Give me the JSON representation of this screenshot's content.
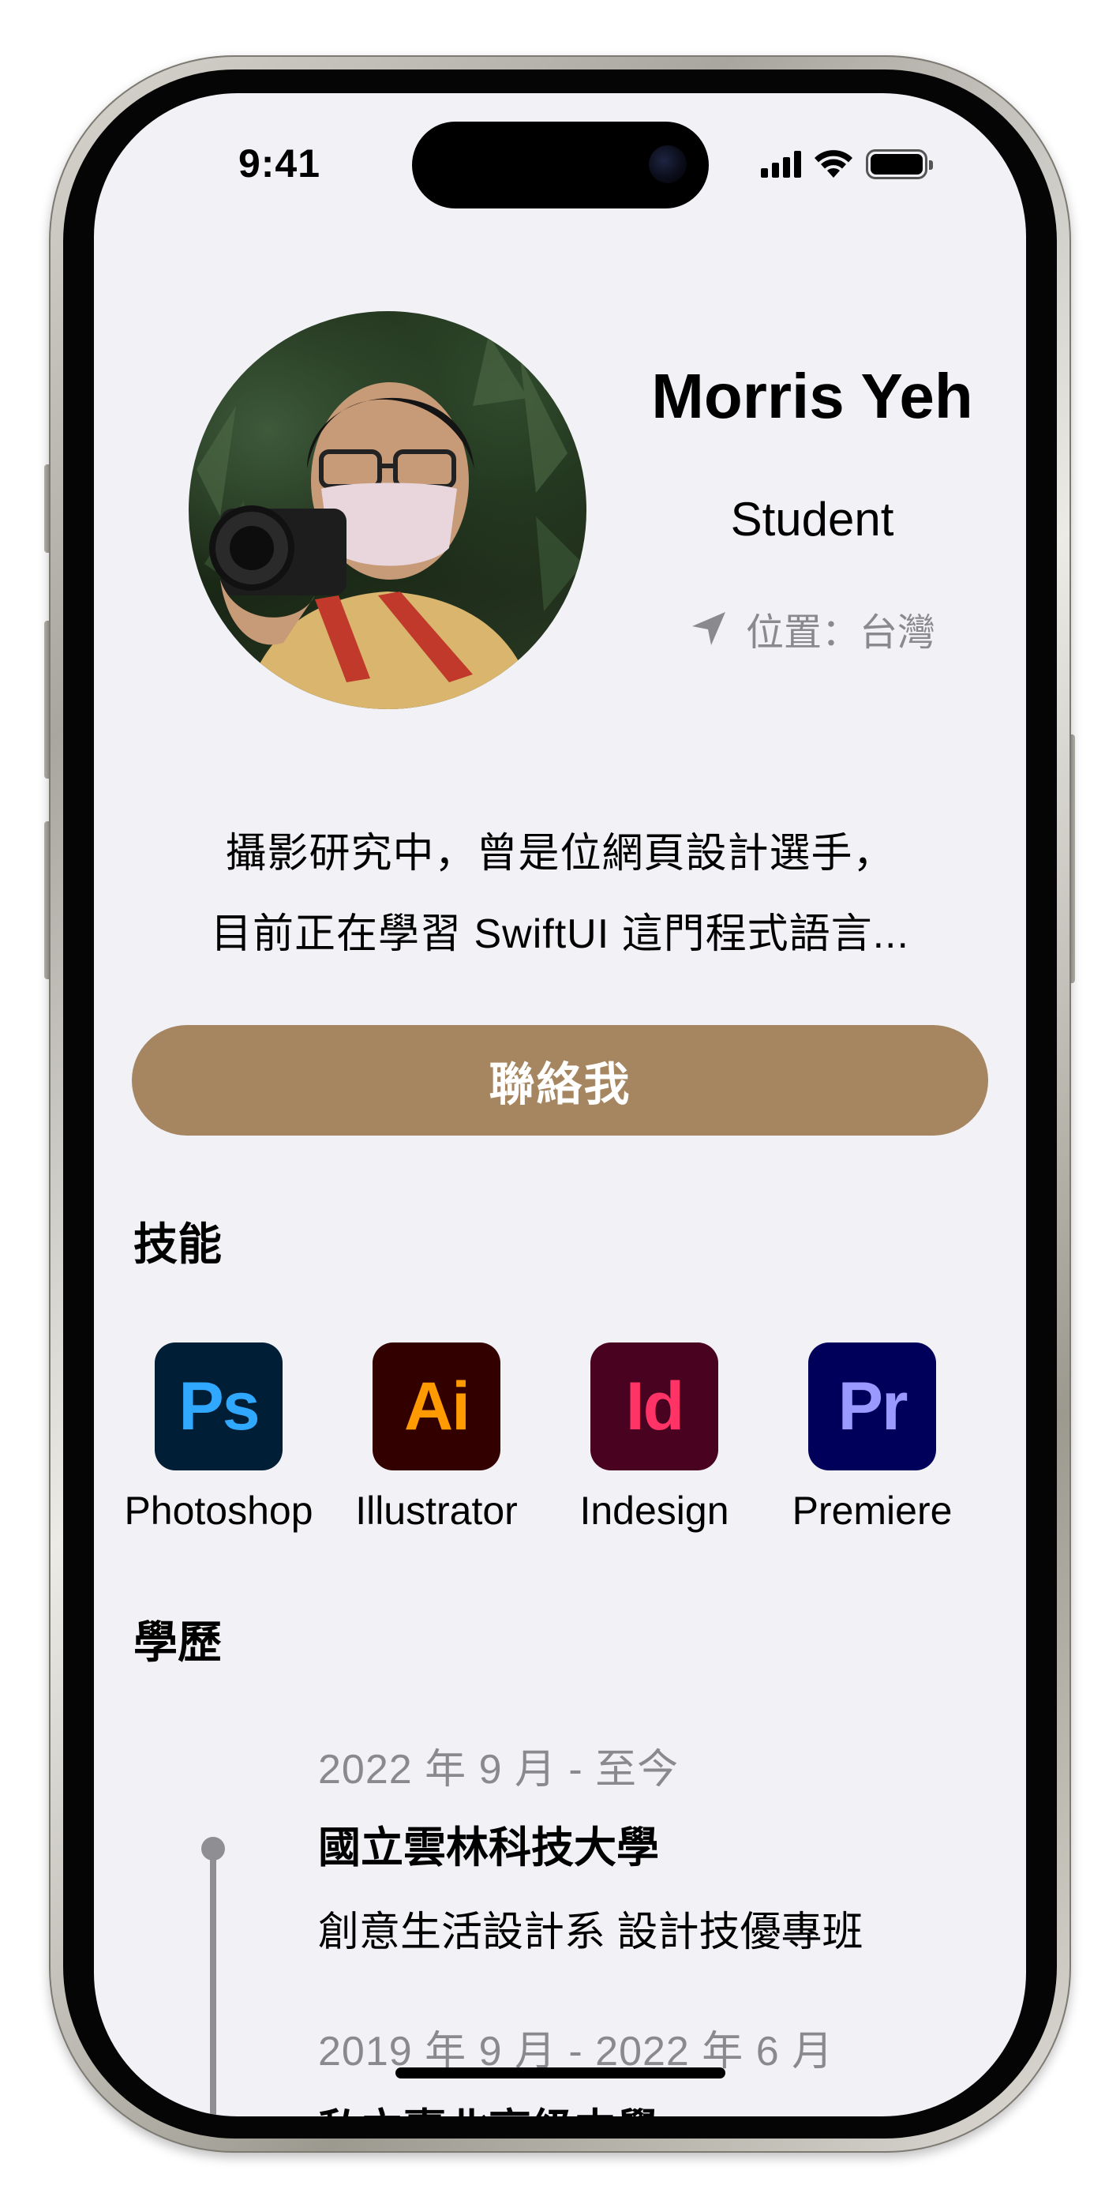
{
  "status_bar": {
    "time": "9:41",
    "battery_level": 1.0
  },
  "profile": {
    "name": "Morris Yeh",
    "role": "Student",
    "location": "位置：台灣"
  },
  "bio": {
    "line1": "攝影研究中，曾是位網頁設計選手，",
    "line2": "目前正在學習 SwiftUI 這門程式語言..."
  },
  "contact_button": {
    "label": "聯絡我"
  },
  "skills": {
    "title": "技能",
    "items": [
      {
        "abbr": "Ps",
        "name": "Photoshop",
        "bg": "#001e36",
        "fg": "#31a8ff"
      },
      {
        "abbr": "Ai",
        "name": "Illustrator",
        "bg": "#330000",
        "fg": "#ff9a00"
      },
      {
        "abbr": "Id",
        "name": "Indesign",
        "bg": "#49021f",
        "fg": "#ff3366"
      },
      {
        "abbr": "Pr",
        "name": "Premiere",
        "bg": "#00005b",
        "fg": "#9999ff"
      }
    ]
  },
  "education": {
    "title": "學歷",
    "items": [
      {
        "date": "2022 年 9 月 - 至今",
        "school": "國立雲林科技大學",
        "dept": "創意生活設計系 設計技優專班"
      },
      {
        "date": "2019 年 9 月 - 2022 年 6 月",
        "school": "私立臺北高級中學",
        "dept": ""
      }
    ]
  },
  "colors": {
    "accent": "#a58661",
    "background": "#f2f1f6",
    "secondary_text": "#8a8a8e",
    "timeline": "#8e8e93"
  }
}
